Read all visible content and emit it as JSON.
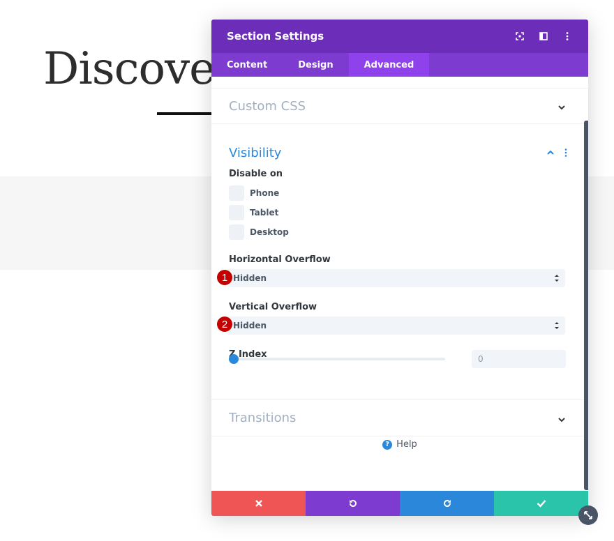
{
  "background": {
    "heading": "Discover"
  },
  "modal": {
    "title": "Section Settings",
    "tabs": [
      {
        "label": "Content"
      },
      {
        "label": "Design"
      },
      {
        "label": "Advanced",
        "active": true
      }
    ],
    "sections": {
      "custom_css": "Custom CSS",
      "visibility": {
        "title": "Visibility",
        "disable_on_label": "Disable on",
        "options": [
          "Phone",
          "Tablet",
          "Desktop"
        ],
        "horizontal_overflow": {
          "label": "Horizontal Overflow",
          "value": "Hidden",
          "badge": "1"
        },
        "vertical_overflow": {
          "label": "Vertical Overflow",
          "value": "Hidden",
          "badge": "2"
        },
        "z_index": {
          "label": "Z Index",
          "value": "0",
          "slider_fraction": 0
        }
      },
      "transitions": "Transitions"
    },
    "help_label": "Help"
  },
  "colors": {
    "header": "#6c2eb9",
    "tabs": "#7e3bd0",
    "active_tab": "#8f42ec",
    "accent": "#2b87da",
    "cancel": "#ef5555",
    "undo": "#7e3bd0",
    "redo": "#2b87da",
    "save": "#29c4a9",
    "badge": "#c40000"
  },
  "icons": {
    "expand": "expand-icon",
    "split": "split-view-icon",
    "more": "more-vertical-icon",
    "chevron_down": "chevron-down-icon",
    "chevron_up": "chevron-up-icon",
    "help": "help-icon",
    "close": "close-icon",
    "undo": "undo-icon",
    "redo": "redo-icon",
    "check": "check-icon",
    "resize": "resize-icon"
  }
}
